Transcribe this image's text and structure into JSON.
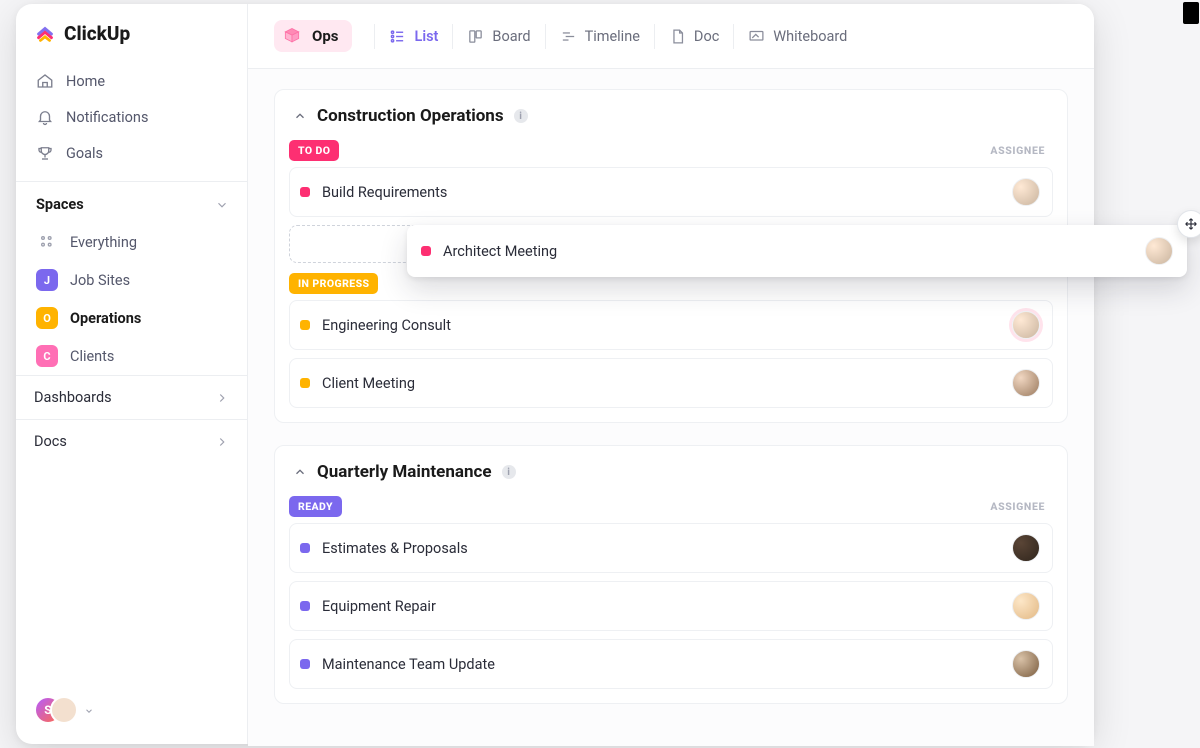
{
  "brand": "ClickUp",
  "nav": {
    "home": "Home",
    "notifications": "Notifications",
    "goals": "Goals"
  },
  "spaces_header": "Spaces",
  "spaces": {
    "everything": "Everything",
    "job_sites": {
      "letter": "J",
      "label": "Job Sites",
      "color": "#7B68EE"
    },
    "operations": {
      "letter": "O",
      "label": "Operations",
      "color": "#ffb300"
    },
    "clients": {
      "letter": "C",
      "label": "Clients",
      "color": "#ff6fb5"
    }
  },
  "sections": {
    "dashboards": "Dashboards",
    "docs": "Docs"
  },
  "footer_avatar_letter": "S",
  "header": {
    "space_name": "Ops",
    "views": {
      "list": "List",
      "board": "Board",
      "timeline": "Timeline",
      "doc": "Doc",
      "whiteboard": "Whiteboard"
    }
  },
  "assignee_label": "ASSIGNEE",
  "groups": [
    {
      "title": "Construction Operations",
      "sections": [
        {
          "status": "TO DO",
          "pill_class": "pill-pink",
          "sq_class": "sq-pink",
          "tasks": [
            "Build Requirements"
          ],
          "has_drop_zone": true,
          "has_drag": true,
          "drag_task": "Architect Meeting"
        },
        {
          "status": "IN PROGRESS",
          "pill_class": "pill-amber",
          "sq_class": "sq-amber",
          "tasks": [
            "Engineering Consult",
            "Client Meeting"
          ]
        }
      ]
    },
    {
      "title": "Quarterly Maintenance",
      "sections": [
        {
          "status": "READY",
          "pill_class": "pill-violet",
          "sq_class": "sq-violet",
          "tasks": [
            "Estimates & Proposals",
            "Equipment Repair",
            "Maintenance Team Update"
          ]
        }
      ]
    }
  ]
}
